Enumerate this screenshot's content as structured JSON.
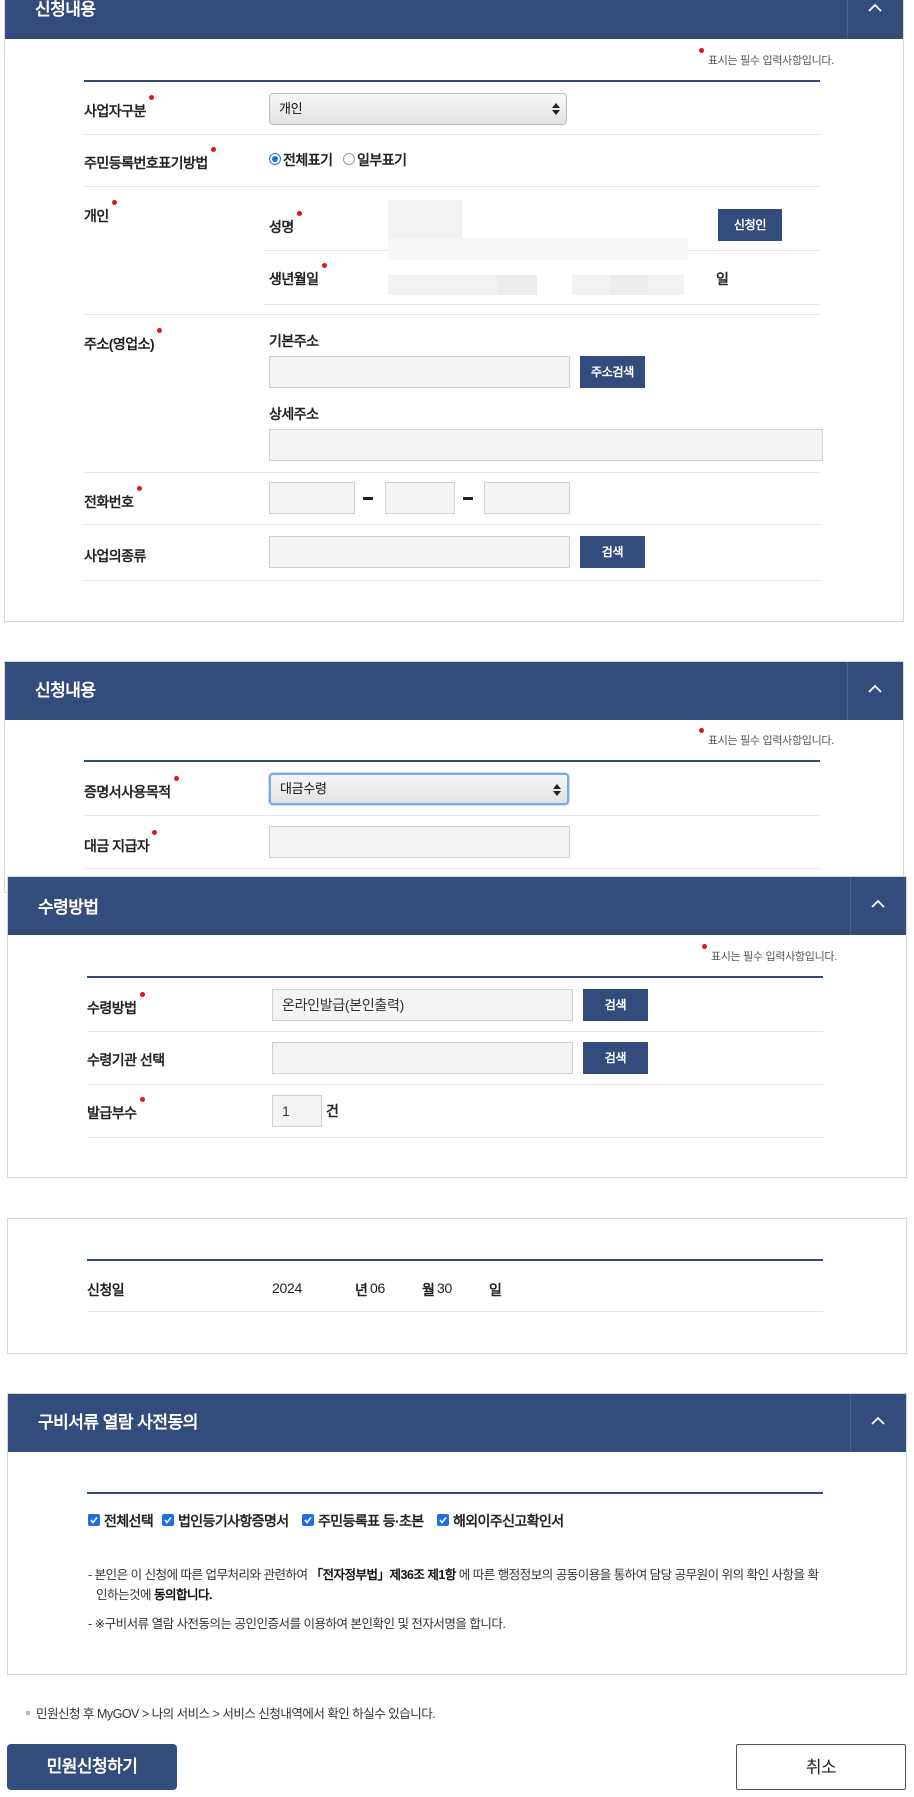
{
  "required_note": "표시는 필수 입력사항입니다.",
  "section1": {
    "title": "신청내용",
    "business_type": {
      "label": "사업자구분",
      "value": "개인"
    },
    "rrn_method": {
      "label": "주민등록번호표기방법",
      "option_full": "전체표기",
      "option_partial": "일부표기",
      "selected": "전체표기"
    },
    "individual": {
      "label": "개인",
      "name_label": "성명",
      "birth_label": "생년월일",
      "day_suffix": "일",
      "applicant_button": "신청인"
    },
    "address": {
      "label": "주소(영업소)",
      "basic_label": "기본주소",
      "search_button": "주소검색",
      "detail_label": "상세주소"
    },
    "phone": {
      "label": "전화번호",
      "sep": "-"
    },
    "business_kind": {
      "label": "사업의종류",
      "search_button": "검색"
    }
  },
  "section2": {
    "title": "신청내용",
    "purpose": {
      "label": "증명서사용목적",
      "value": "대금수령"
    },
    "payer": {
      "label": "대금 지급자"
    }
  },
  "section3": {
    "title": "수령방법",
    "method": {
      "label": "수령방법",
      "value": "온라인발급(본인출력)",
      "button": "검색"
    },
    "agency": {
      "label": "수령기관 선택",
      "button": "검색"
    },
    "copies": {
      "label": "발급부수",
      "value": "1",
      "unit": "건"
    }
  },
  "section4": {
    "date_label": "신청일",
    "year": "2024",
    "year_unit": "년",
    "month": "06",
    "month_unit": "월",
    "day": "30",
    "day_unit": "일"
  },
  "section5": {
    "title": "구비서류 열람 사전동의",
    "checks": [
      "전체선택",
      "법인등기사항증명서",
      "주민등록표 등·초본",
      "해외이주신고확인서"
    ],
    "notice1_a": "- 본인은 이 신청에 따른 업무처리와 관련하여 ",
    "notice1_b": "「전자정부법」제36조 제1항",
    "notice1_c": " 에 따른 행정정보의 공동이용을 통하여 담당 공무원이 위의 확인 사항을 확",
    "notice1_d": "인하는것에 ",
    "notice1_e": "동의합니다.",
    "notice2": "- ※구비서류 열람 사전동의는 공인인증서를 이용하여 본인확인 및 전자서명을 합니다."
  },
  "footnote": "민원신청 후 MyGOV > 나의 서비스 > 서비스 신청내역에서 확인 하실수 있습니다.",
  "buttons": {
    "submit": "민원신청하기",
    "cancel": "취소"
  },
  "colors": {
    "header": "#324c7c",
    "required_dot": "#e0151b",
    "accent": "#1f6fe0"
  }
}
